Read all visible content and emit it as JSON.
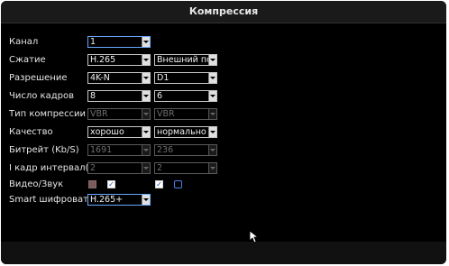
{
  "window": {
    "title": "Компрессия"
  },
  "fields": {
    "channel": {
      "label": "Канал",
      "value": "1"
    },
    "compression": {
      "label": "Сжатие",
      "main": "H.265",
      "sub": "Внешний пот"
    },
    "resolution": {
      "label": "Разрешение",
      "main": "4K-N",
      "sub": "D1"
    },
    "frame_rate": {
      "label": "Число кадров",
      "main": "8",
      "sub": "6"
    },
    "compression_type": {
      "label": "Тип компрессии",
      "main": "VBR",
      "sub": "VBR"
    },
    "quality": {
      "label": "Качество",
      "main": "хорошо",
      "sub": "нормально"
    },
    "bitrate": {
      "label": "Битрейт (Kb/S)",
      "main": "1691",
      "sub": "236"
    },
    "i_frame_interval": {
      "label": "I кадр интервал(S)",
      "main": "2",
      "sub": "2"
    },
    "video_audio": {
      "label": "Видео/Звук",
      "main_video_checked": true,
      "main_audio_checked": true,
      "sub_video_checked": true,
      "sub_audio_checked": false
    },
    "smart_codec": {
      "label": "Smart шифровать",
      "value": "H.265+"
    }
  },
  "icons": {
    "checkmark": "✓",
    "cursor": "mouse-pointer-icon"
  }
}
